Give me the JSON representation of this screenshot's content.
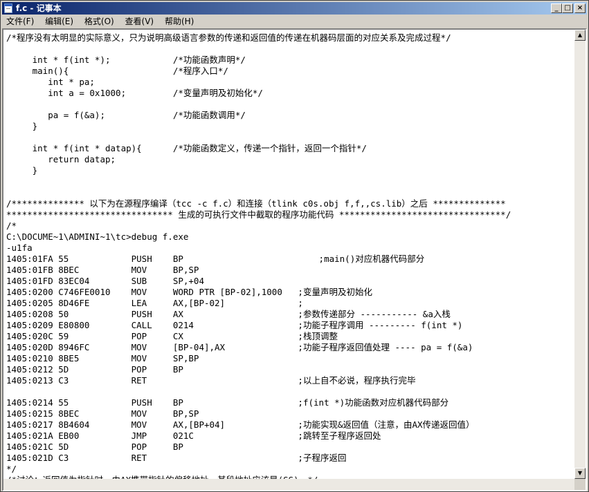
{
  "window": {
    "title": "f.c - 记事本",
    "minimize_glyph": "_",
    "maximize_glyph": "□",
    "close_glyph": "×"
  },
  "menu": {
    "items": [
      {
        "label": "文件(F)"
      },
      {
        "label": "编辑(E)"
      },
      {
        "label": "格式(O)"
      },
      {
        "label": "查看(V)"
      },
      {
        "label": "帮助(H)"
      }
    ]
  },
  "scrollbar": {
    "up": "▲",
    "down": "▼"
  },
  "content": {
    "lines": [
      "/*程序没有太明显的实际意义，只为说明高级语言参数的传递和返回值的传递在机器码层面的对应关系及完成过程*/",
      "",
      "     int * f(int *);            /*功能函数声明*/",
      "     main(){                    /*程序入口*/",
      "        int * pa;",
      "        int a = 0x1000;         /*变量声明及初始化*/",
      "",
      "        pa = f(&a);             /*功能函数调用*/",
      "     }",
      "",
      "     int * f(int * datap){      /*功能函数定义，传递一个指针，返回一个指针*/",
      "        return datap;",
      "     }",
      "",
      "",
      "/************** 以下为在源程序编译（tcc -c f.c）和连接（tlink c0s.obj f,f,,cs.lib）之后 **************",
      "******************************** 生成的可执行文件中截取的程序功能代码 ********************************/",
      "/*",
      "C:\\DOCUME~1\\ADMINI~1\\tc>debug f.exe",
      "-u1fa",
      "1405:01FA 55            PUSH    BP                          ;main()对应机器代码部分",
      "1405:01FB 8BEC          MOV     BP,SP",
      "1405:01FD 83EC04        SUB     SP,+04",
      "1405:0200 C746FE0010    MOV     WORD PTR [BP-02],1000   ;变量声明及初始化",
      "1405:0205 8D46FE        LEA     AX,[BP-02]              ;",
      "1405:0208 50            PUSH    AX                      ;参数传递部分 ----------- &a入栈",
      "1405:0209 E80800        CALL    0214                    ;功能子程序调用 --------- f(int *)",
      "1405:020C 59            POP     CX                      ;栈顶调整",
      "1405:020D 8946FC        MOV     [BP-04],AX              ;功能子程序返回值处理 ---- pa = f(&a)",
      "1405:0210 8BE5          MOV     SP,BP",
      "1405:0212 5D            POP     BP",
      "1405:0213 C3            RET                             ;以上自不必说，程序执行完毕",
      "",
      "1405:0214 55            PUSH    BP                      ;f(int *)功能函数对应机器代码部分",
      "1405:0215 8BEC          MOV     BP,SP",
      "1405:0217 8B4604        MOV     AX,[BP+04]              ;功能实现&返回值（注意，由AX传递返回值）",
      "1405:021A EB00          JMP     021C                    ;跳转至子程序返回处",
      "1405:021C 5D            POP     BP",
      "1405:021D C3            RET                             ;子程序返回",
      "*/",
      "/*讨论：返回值为指针时，由AX携带指针的偏移地址，其段地址应该是(SS)。*/"
    ]
  }
}
